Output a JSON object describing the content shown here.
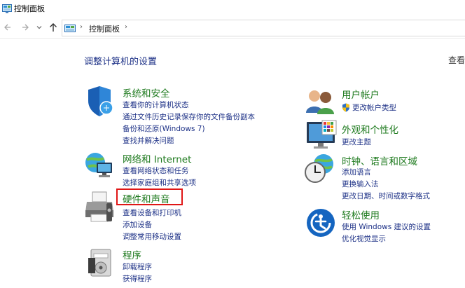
{
  "window": {
    "title": "控制面板"
  },
  "nav": {
    "breadcrumb": "控制面板"
  },
  "main": {
    "heading": "调整计算机的设置",
    "view_by": "查看",
    "left": [
      {
        "title": "系统和安全",
        "icon": "shield-icon",
        "links": [
          "查看你的计算机状态",
          "通过文件历史记录保存你的文件备份副本",
          "备份和还原(Windows 7)",
          "查找并解决问题"
        ]
      },
      {
        "title": "网络和 Internet",
        "icon": "network-globe-icon",
        "links": [
          "查看网络状态和任务",
          "选择家庭组和共享选项"
        ]
      },
      {
        "title": "硬件和声音",
        "icon": "printer-icon",
        "links": [
          "查看设备和打印机",
          "添加设备",
          "调整常用移动设置"
        ]
      },
      {
        "title": "程序",
        "icon": "programs-icon",
        "links": [
          "卸载程序",
          "获得程序"
        ]
      }
    ],
    "right": [
      {
        "title": "用户帐户",
        "icon": "users-icon",
        "links": [
          "更改帐户类型"
        ]
      },
      {
        "title": "外观和个性化",
        "icon": "monitor-palette-icon",
        "links": [
          "更改主题"
        ]
      },
      {
        "title": "时钟、语言和区域",
        "icon": "clock-globe-icon",
        "links": [
          "添加语言",
          "更换输入法",
          "更改日期、时间或数字格式"
        ]
      },
      {
        "title": "轻松使用",
        "icon": "ease-of-access-icon",
        "links": [
          "使用 Windows 建议的设置",
          "优化视觉显示"
        ]
      }
    ]
  },
  "colors": {
    "category_title": "#1e7a1e",
    "link": "#1e3287",
    "highlight_box": "#e01616"
  }
}
